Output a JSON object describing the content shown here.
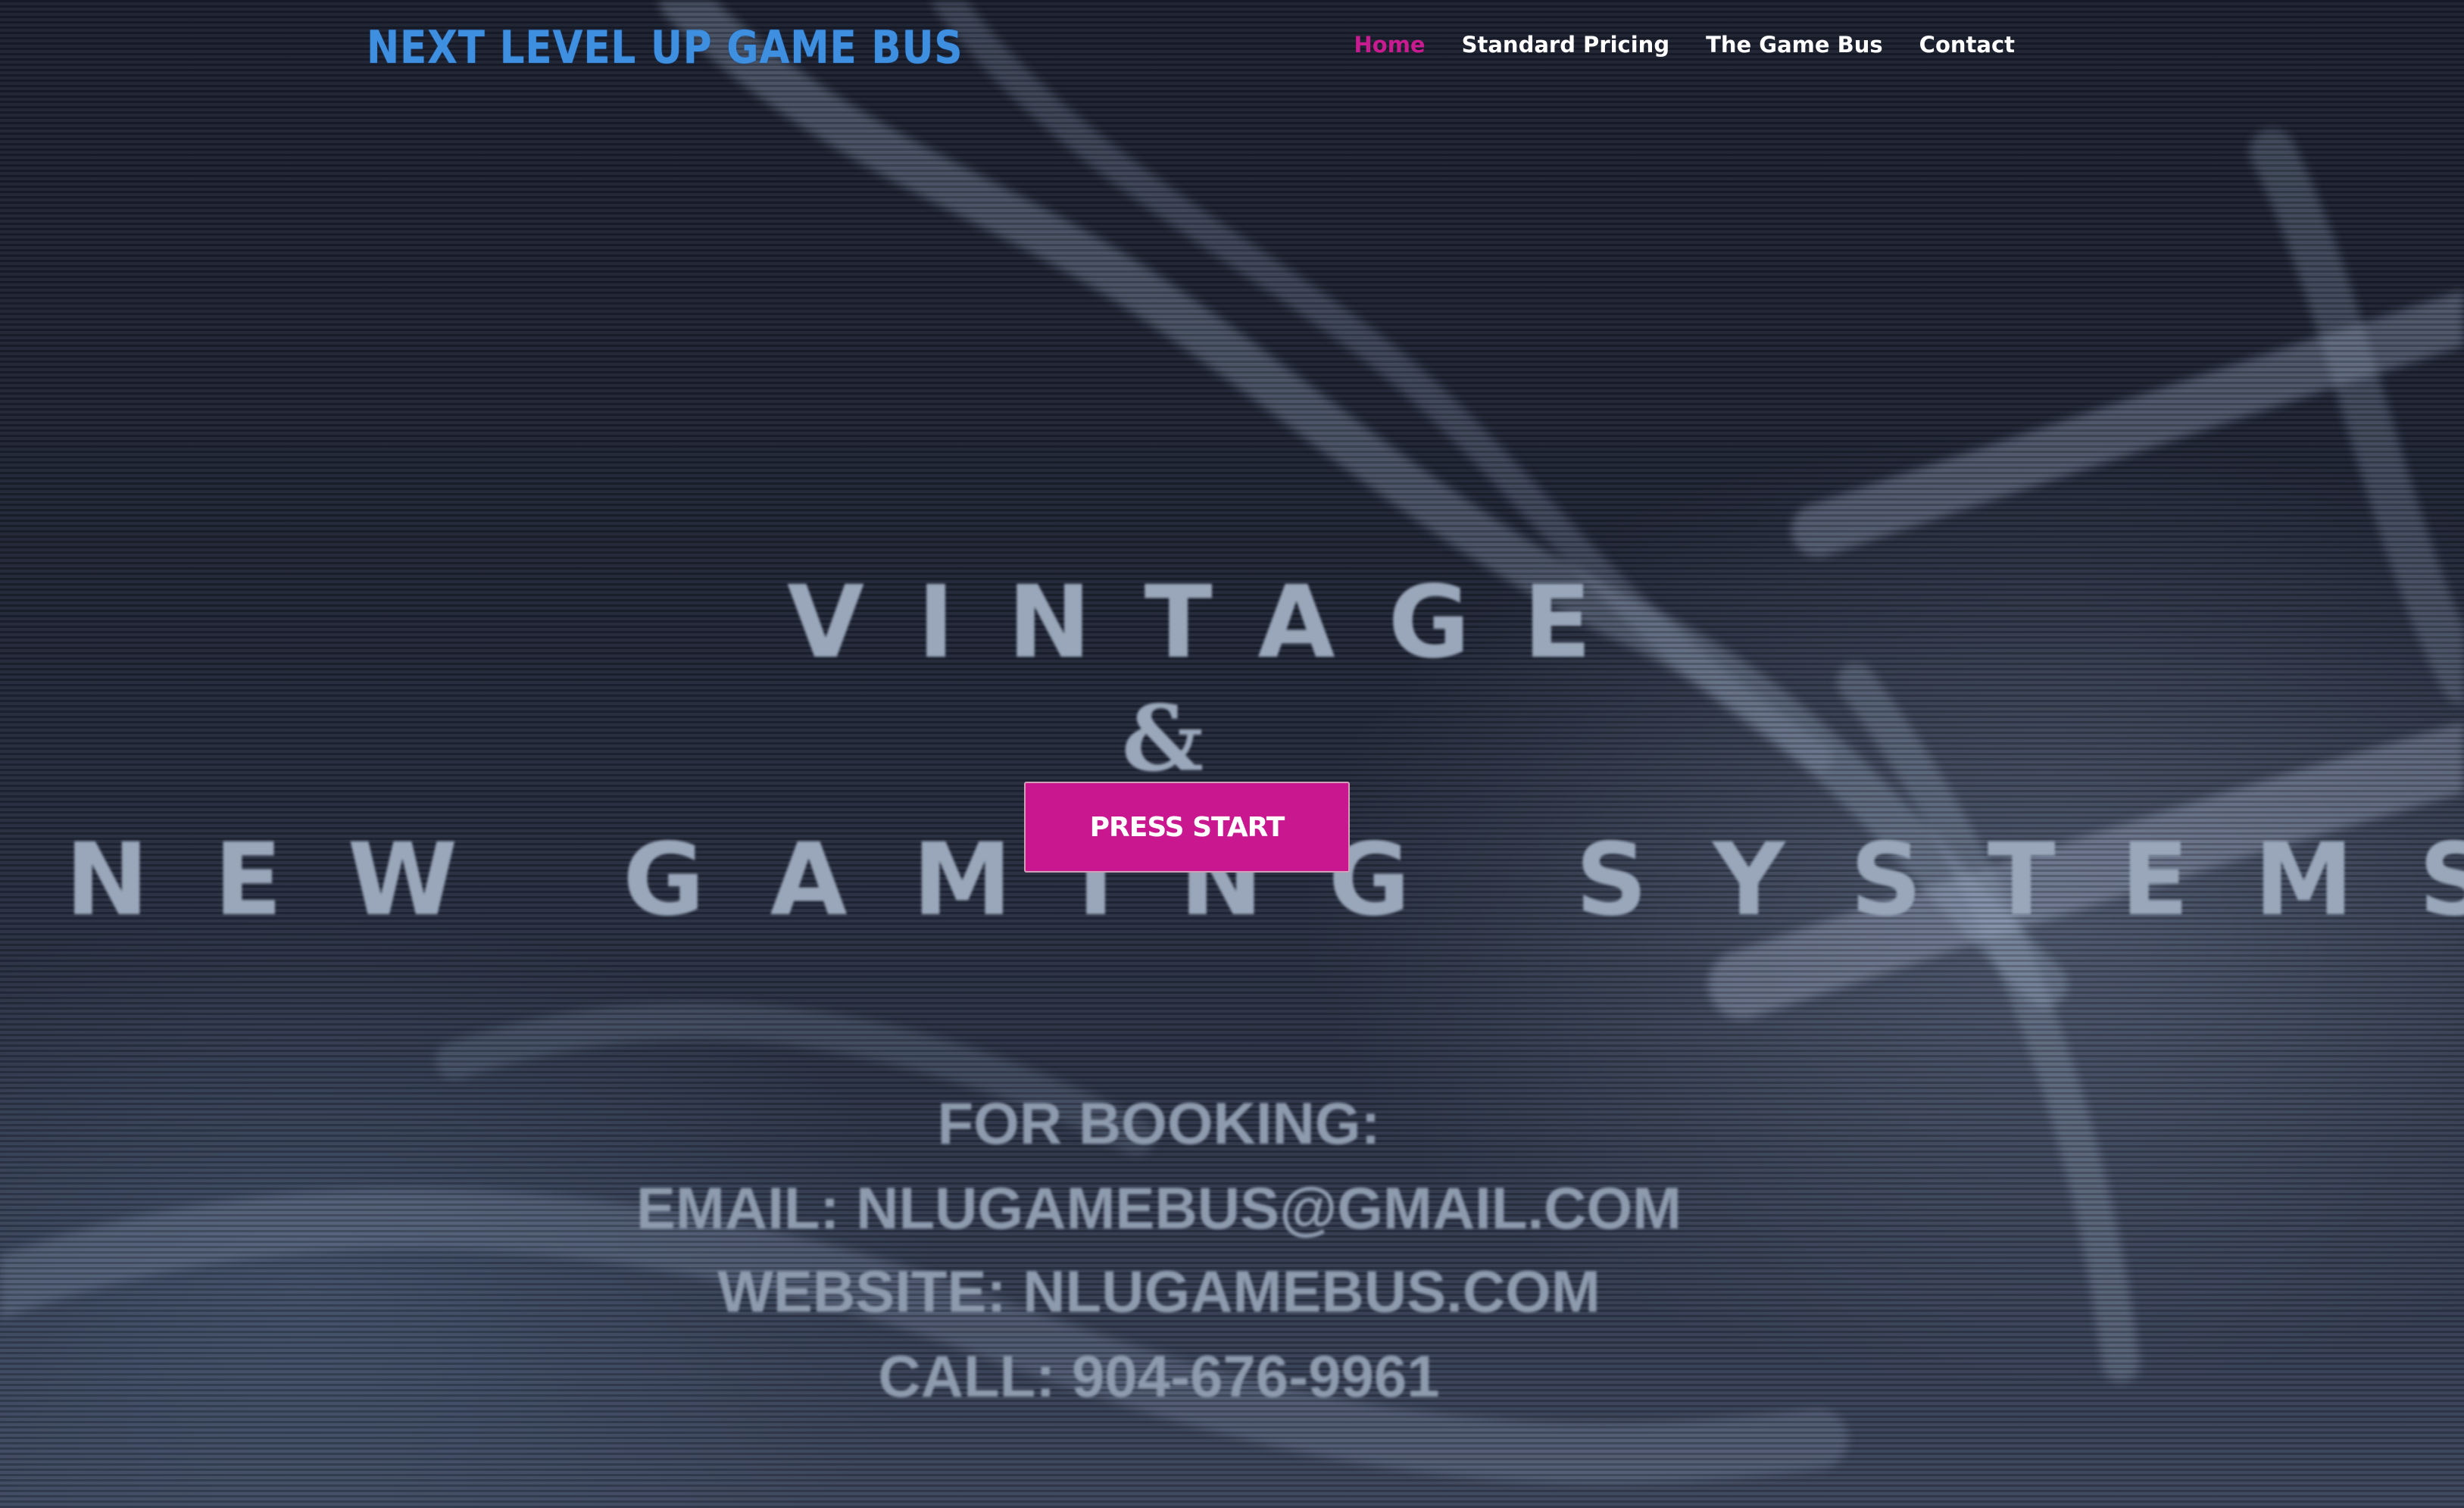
{
  "header": {
    "logo_text": "NEXT LEVEL UP GAME BUS",
    "nav": [
      {
        "label": "Home",
        "active": true
      },
      {
        "label": "Standard Pricing",
        "active": false
      },
      {
        "label": "The Game Bus",
        "active": false
      },
      {
        "label": "Contact",
        "active": false
      }
    ]
  },
  "hero": {
    "line1": "VINTAGE",
    "line2": "&",
    "line3": "NEW GAMING SYSTEMS",
    "cta_label": "PRESS START"
  },
  "booking": {
    "line1": "FOR BOOKING:",
    "line2": "EMAIL: NLUGAMEBUS@GMAIL.COM",
    "line3": "WEBSITE: NLUGAMEBUS.COM",
    "line4": "CALL: 904-676-9961"
  },
  "colors": {
    "accent": "#c8178f",
    "logo": "#3e8fe0",
    "background": "#1c2233"
  }
}
